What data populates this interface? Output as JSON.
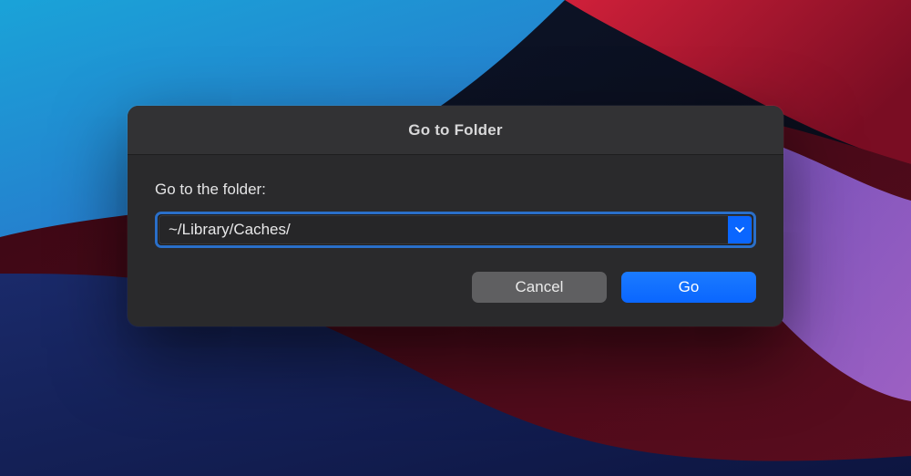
{
  "dialog": {
    "title": "Go to Folder",
    "label": "Go to the folder:",
    "input_value": "~/Library/Caches/",
    "dropdown_icon": "chevron-down",
    "buttons": {
      "cancel": "Cancel",
      "go": "Go"
    }
  },
  "colors": {
    "accent": "#0a66ff",
    "dialog_bg": "#2a2a2c",
    "titlebar_bg": "#323234"
  }
}
